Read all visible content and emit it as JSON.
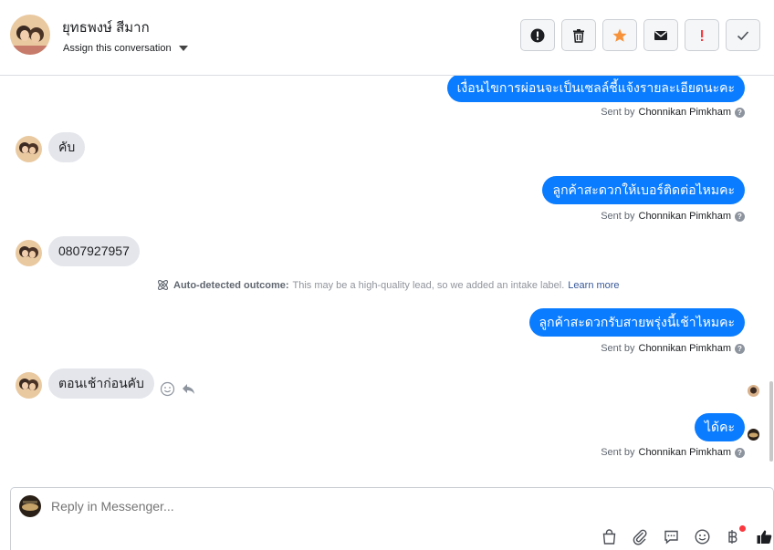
{
  "header": {
    "contact_name": "ยุทธพงษ์ สีมาก",
    "assign_label": "Assign this conversation"
  },
  "actions": [
    "alert-icon",
    "trash-icon",
    "star-icon",
    "envelope-icon",
    "exclamation-icon",
    "check-icon"
  ],
  "thread": {
    "messages": [
      {
        "dir": "out",
        "text": "เงื่อนไขการผ่อนจะเป็นเซลล์ชี้แจ้งรายละเอียดนะคะ",
        "sent_by_label": "Sent by",
        "sender": "Chonnikan Pimkham"
      },
      {
        "dir": "in",
        "text": "คับ"
      },
      {
        "dir": "out",
        "text": "ลูกค้าสะดวกให้เบอร์ติดต่อไหมคะ",
        "sent_by_label": "Sent by",
        "sender": "Chonnikan Pimkham"
      },
      {
        "dir": "in",
        "text": "0807927957"
      },
      {
        "dir": "out",
        "text": "ลูกค้าสะดวกรับสายพรุ่งนี้เช้าไหมคะ",
        "sent_by_label": "Sent by",
        "sender": "Chonnikan Pimkham"
      },
      {
        "dir": "in",
        "text": "ตอนเช้าก่อนคับ"
      },
      {
        "dir": "out",
        "text": "ได้คะ",
        "sent_by_label": "Sent by",
        "sender": "Chonnikan Pimkham"
      }
    ],
    "note": {
      "title": "Auto-detected outcome:",
      "text": "This may be a high-quality lead, so we added an intake label.",
      "link": "Learn more"
    }
  },
  "composer": {
    "placeholder": "Reply in Messenger...",
    "tools": [
      "bag-icon",
      "paperclip-icon",
      "chat-icon",
      "emoji-icon",
      "baht-icon",
      "thumbs-up-icon"
    ]
  },
  "colors": {
    "outgoing_bubble": "#0a7cff",
    "incoming_bubble": "#e4e6eb",
    "star": "#f7923a",
    "alert_red": "#fa383e"
  }
}
